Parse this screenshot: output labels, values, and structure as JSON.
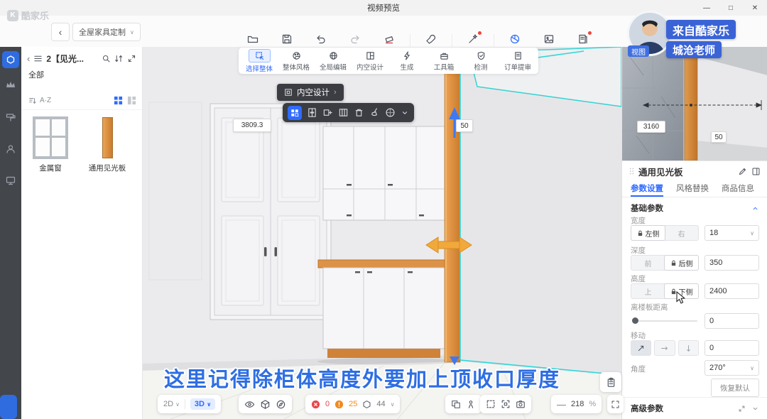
{
  "colors": {
    "accent_blue": "#2f6bff",
    "selection_teal": "#31d6d6",
    "board_orange": "#de8f44",
    "subtitle_blue": "#2e6ee3",
    "error_red": "#e5484d",
    "warning_orange": "#f08a1d",
    "badge_blue": "#3a63d6"
  },
  "window": {
    "title": "视频预览"
  },
  "topbar": {
    "logo": "酷家乐",
    "mode_dropdown": "全屋家具定制",
    "items": [
      {
        "label": "文件"
      },
      {
        "label": "保存"
      },
      {
        "label": "撤销"
      },
      {
        "label": "恢复"
      },
      {
        "label": "清空"
      },
      {
        "label": "工具"
      },
      {
        "label": "智能设计"
      },
      {
        "label": "渲染"
      },
      {
        "label": "图册"
      },
      {
        "label": "图纸&清单"
      }
    ]
  },
  "watermark": {
    "line1": "来自酷家乐",
    "line2": "城沧老师",
    "view_badge": "视图"
  },
  "ribbon": {
    "items": [
      {
        "label": "选择整体"
      },
      {
        "label": "整体风格"
      },
      {
        "label": "全局编辑"
      },
      {
        "label": "内空设计"
      },
      {
        "label": "生成"
      },
      {
        "label": "工具箱"
      },
      {
        "label": "检测"
      },
      {
        "label": "订单提审"
      }
    ]
  },
  "catalog": {
    "title": "2【见光...",
    "all_label": "全部",
    "sort_label": "A·Z",
    "items": [
      {
        "name": "金属窗"
      },
      {
        "name": "通用见光板"
      }
    ]
  },
  "viewport": {
    "dim_width": "3809.3",
    "dim_height_gap": "50",
    "context_button": "内空设计",
    "subtitle": "这里记得除柜体高度外要加上顶收口厚度"
  },
  "preview": {
    "dim_width": "3160",
    "dim_gap": "50"
  },
  "bottombar": {
    "mode_2d": "2D",
    "mode_3d": "3D",
    "error_count": "0",
    "warning_count": "25",
    "model_count": "44",
    "zoom_value": "218",
    "zoom_unit": "%"
  },
  "inspector": {
    "title": "通用见光板",
    "tabs": [
      {
        "label": "参数设置"
      },
      {
        "label": "风格替换"
      },
      {
        "label": "商品信息"
      }
    ],
    "basic_section": "基础参数",
    "width": {
      "label": "宽度",
      "opt_left": "左侧",
      "opt_right": "右",
      "value": "18"
    },
    "depth": {
      "label": "深度",
      "opt_front": "前",
      "opt_back": "后侧",
      "value": "350"
    },
    "height": {
      "label": "高度",
      "opt_top": "上",
      "opt_bottom": "下侧",
      "value": "2400"
    },
    "floor_distance": {
      "label": "离楼板距离",
      "value": "0"
    },
    "move": {
      "label": "移动",
      "value": "0"
    },
    "angle": {
      "label": "角度",
      "value": "270°"
    },
    "reset_button": "恢复默认",
    "advanced_section": "高级参数"
  }
}
